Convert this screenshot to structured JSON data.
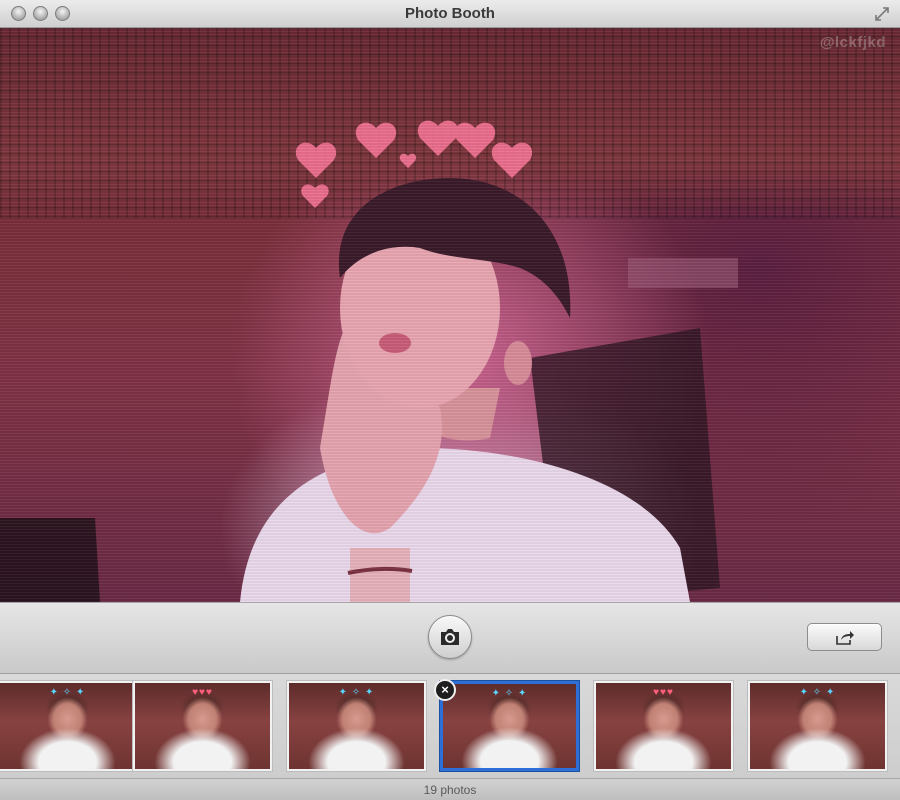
{
  "window": {
    "title": "Photo Booth"
  },
  "viewport": {
    "watermark": "@lckfjkd",
    "effect": "hearts-crown"
  },
  "toolbar": {
    "shutter_icon": "camera-icon",
    "share_icon": "share-icon"
  },
  "filmstrip": {
    "selected_index": 3,
    "photos": [
      {
        "decoration": "cyan-birds"
      },
      {
        "decoration": "red-hearts"
      },
      {
        "decoration": "cyan-birds"
      },
      {
        "decoration": "cyan-birds"
      },
      {
        "decoration": "red-hearts"
      },
      {
        "decoration": "cyan-birds"
      }
    ]
  },
  "status": {
    "count_label": "19 photos"
  },
  "colors": {
    "selection": "#2d6fd6",
    "hearts": "#ff7a9c"
  }
}
